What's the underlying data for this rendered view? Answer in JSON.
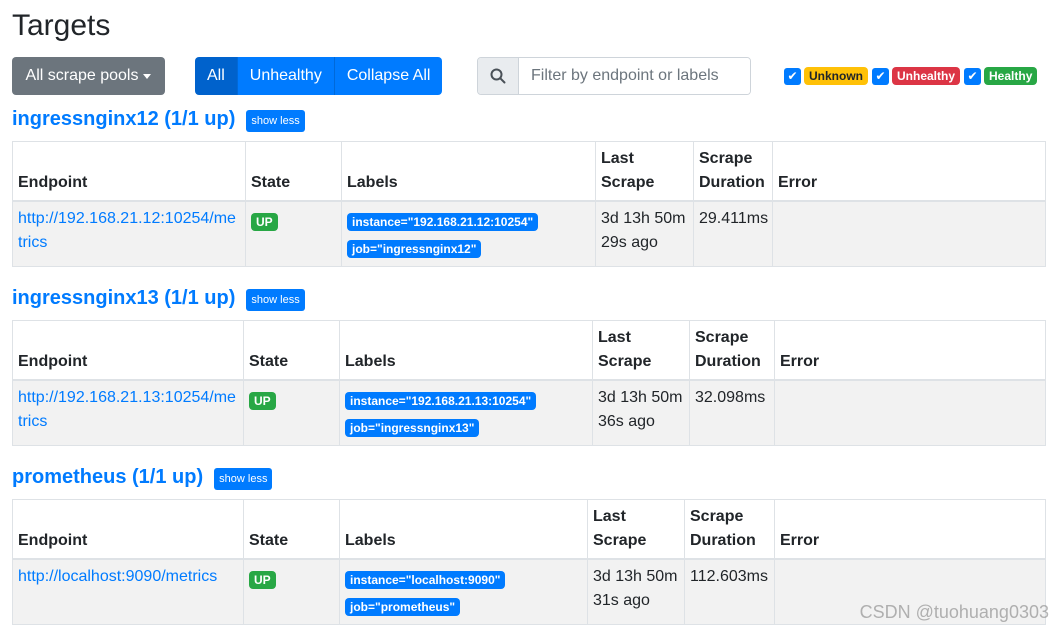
{
  "page": {
    "title": "Targets"
  },
  "toolbar": {
    "pools_label": "All scrape pools",
    "filter_buttons": [
      "All",
      "Unhealthy",
      "Collapse All"
    ],
    "filter_placeholder": "Filter by endpoint or labels",
    "health": [
      "Unknown",
      "Unhealthy",
      "Healthy"
    ]
  },
  "table_headers": {
    "endpoint": "Endpoint",
    "state": "State",
    "labels": "Labels",
    "last_scrape": "Last Scrape",
    "scrape_duration": "Scrape Duration",
    "error": "Error"
  },
  "pools": [
    {
      "title": "ingressnginx12 (1/1 up)",
      "toggle": "show less",
      "rows": [
        {
          "endpoint": "http://192.168.21.12:10254/metrics",
          "state": "UP",
          "labels": [
            "instance=\"192.168.21.12:10254\"",
            "job=\"ingressnginx12\""
          ],
          "last_scrape": "3d 13h 50m 29s ago",
          "duration": "29.411ms",
          "error": ""
        }
      ]
    },
    {
      "title": "ingressnginx13 (1/1 up)",
      "toggle": "show less",
      "rows": [
        {
          "endpoint": "http://192.168.21.13:10254/metrics",
          "state": "UP",
          "labels": [
            "instance=\"192.168.21.13:10254\"",
            "job=\"ingressnginx13\""
          ],
          "last_scrape": "3d 13h 50m 36s ago",
          "duration": "32.098ms",
          "error": ""
        }
      ]
    },
    {
      "title": "prometheus (1/1 up)",
      "toggle": "show less",
      "rows": [
        {
          "endpoint": "http://localhost:9090/metrics",
          "state": "UP",
          "labels": [
            "instance=\"localhost:9090\"",
            "job=\"prometheus\""
          ],
          "last_scrape": "3d 13h 50m 31s ago",
          "duration": "112.603ms",
          "error": ""
        }
      ]
    }
  ],
  "watermark": "CSDN @tuohuang0303",
  "colors": {
    "primary": "#007bff",
    "success": "#28a745",
    "danger": "#dc3545",
    "warning": "#ffc107",
    "secondary": "#6c757d"
  }
}
